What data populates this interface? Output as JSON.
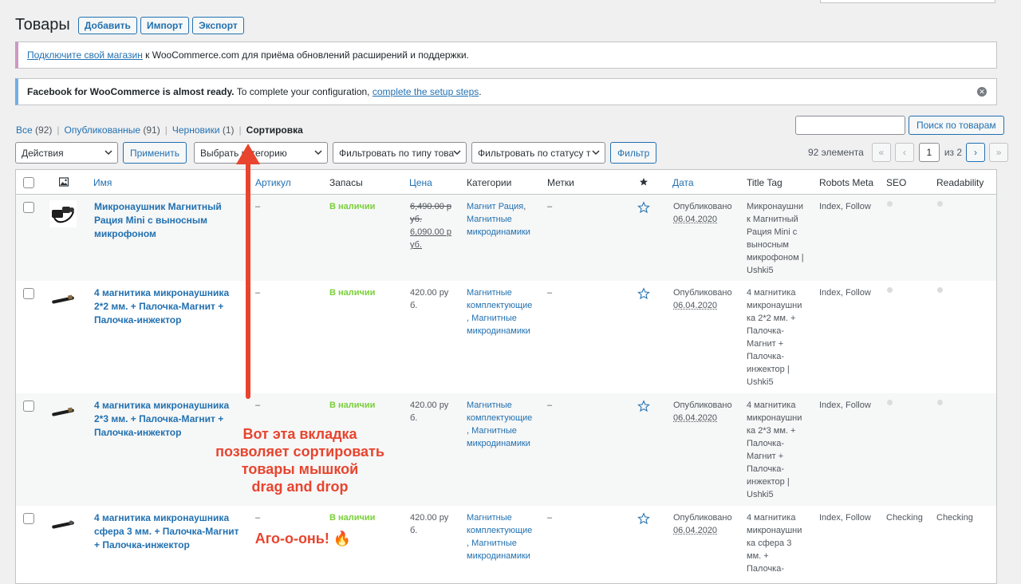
{
  "header": {
    "title": "Товары",
    "buttons": [
      "Добавить",
      "Импорт",
      "Экспорт"
    ]
  },
  "notices": {
    "woo": {
      "link": "Подключите свой магазин",
      "text": " к WooCommerce.com для приёма обновлений расширений и поддержки."
    },
    "facebook": {
      "bold": "Facebook for WooCommerce is almost ready.",
      "text": " To complete your configuration, ",
      "link": "complete the setup steps",
      "end": "."
    }
  },
  "views": {
    "all": "Все",
    "all_count": "(92)",
    "published": "Опубликованные",
    "published_count": "(91)",
    "drafts": "Черновики",
    "drafts_count": "(1)",
    "sorting": "Сортировка"
  },
  "search": {
    "button": "Поиск по товарам",
    "value": ""
  },
  "filters": {
    "bulk_action": "Действия",
    "apply": "Применить",
    "category": "Выбрать категорию",
    "type": "Фильтровать по типу това",
    "status": "Фильтровать по статусу т",
    "filter": "Фильтр"
  },
  "pagination": {
    "count": "92 элемента",
    "first": "«",
    "prev": "‹",
    "current": "1",
    "of": "из 2",
    "next": "›",
    "last": "»"
  },
  "columns": {
    "name": "Имя",
    "sku": "Артикул",
    "stock": "Запасы",
    "price": "Цена",
    "categories": "Категории",
    "tags": "Метки",
    "date": "Дата",
    "title_tag": "Title Tag",
    "robots": "Robots Meta",
    "seo": "SEO",
    "readability": "Readability"
  },
  "products": [
    {
      "name": [
        "Микронаушник Магнитный",
        "Рация Mini с выносным",
        "микрофоном"
      ],
      "sku": "–",
      "stock": "В наличии",
      "price_old": [
        "6,490.00 р",
        "уб."
      ],
      "price_new": [
        "6,090.00 р",
        "уб."
      ],
      "categories": [
        "Магнит Рация",
        ",",
        "Магнитные",
        "микродинамики"
      ],
      "tags": "–",
      "status": "Опубликовано",
      "date": "06.04.2020",
      "title_tag": [
        "Микронаушни",
        "к Магнитный",
        "Рация Mini с",
        "выносным",
        "микрофоном |",
        "Ushki5"
      ],
      "robots": "Index, Follow",
      "seo": "",
      "readability": ""
    },
    {
      "name": [
        "4 магнитика микронаушника",
        "2*2 мм. + Палочка-Магнит +",
        "Палочка-инжектор"
      ],
      "sku": "–",
      "stock": "В наличии",
      "price": [
        "420.00 ру",
        "б."
      ],
      "categories": [
        "Магнитные",
        "комплектующие",
        ", Магнитные",
        "микродинамики"
      ],
      "tags": "–",
      "status": "Опубликовано",
      "date": "06.04.2020",
      "title_tag": [
        "4 магнитика",
        "микронаушни",
        "ка 2*2 мм. +",
        "Палочка-",
        "Магнит +",
        "Палочка-",
        "инжектор |",
        "Ushki5"
      ],
      "robots": "Index, Follow",
      "seo": "",
      "readability": ""
    },
    {
      "name": [
        "4 магнитика микронаушника",
        "2*3 мм. + Палочка-Магнит +",
        "Палочка-инжектор"
      ],
      "sku": "–",
      "stock": "В наличии",
      "price": [
        "420.00 ру",
        "б."
      ],
      "categories": [
        "Магнитные",
        "комплектующие",
        ", Магнитные",
        "микродинамики"
      ],
      "tags": "–",
      "status": "Опубликовано",
      "date": "06.04.2020",
      "title_tag": [
        "4 магнитика",
        "микронаушни",
        "ка 2*3 мм. +",
        "Палочка-",
        "Магнит +",
        "Палочка-",
        "инжектор |",
        "Ushki5"
      ],
      "robots": "Index, Follow",
      "seo": "",
      "readability": ""
    },
    {
      "name": [
        "4 магнитика микронаушника",
        "сфера 3 мм. + Палочка-Магнит",
        "+ Палочка-инжектор"
      ],
      "sku": "–",
      "stock": "В наличии",
      "price": [
        "420.00 ру",
        "б."
      ],
      "categories": [
        "Магнитные",
        "комплектующие",
        ", Магнитные",
        "микродинамики"
      ],
      "tags": "–",
      "status": "Опубликовано",
      "date": "06.04.2020",
      "title_tag": [
        "4 магнитика",
        "микронаушни",
        "ка сфера 3",
        "мм. +",
        "Палочка-"
      ],
      "robots": "Index, Follow",
      "seo": "Checking",
      "readability": "Checking"
    }
  ],
  "annotation": {
    "lines": [
      "Вот эта вкладка",
      "позволяет сортировать",
      "товары мышкой",
      "drag and drop"
    ],
    "second": "Аго-о-онь! 🔥",
    "color": "#e8442e"
  }
}
